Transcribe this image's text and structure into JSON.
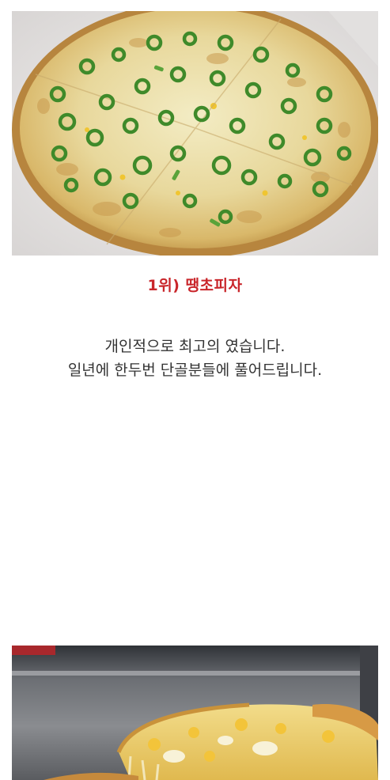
{
  "colors": {
    "rank_title": "#c9262b",
    "caption_text": "#333333",
    "background": "#ffffff"
  },
  "post": {
    "rank_title": "1위) 땡초피자",
    "caption_lines": [
      "개인적으로 최고의 였습니다.",
      "일년에 한두번 단골분들에 풀어드립니다."
    ]
  }
}
